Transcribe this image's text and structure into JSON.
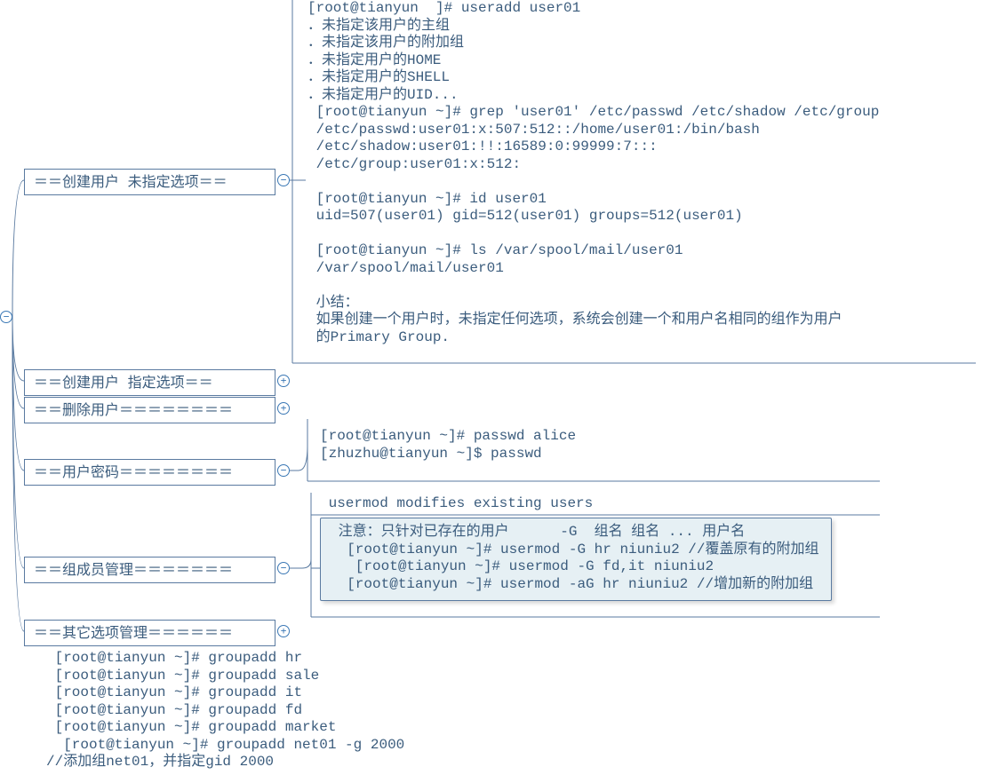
{
  "root_toggle": "minus",
  "nodes": {
    "n1": {
      "label": "＝＝创建用户 未指定选项＝＝",
      "toggle": "minus"
    },
    "n2": {
      "label": "＝＝创建用户    指定选项＝＝",
      "toggle": "plus"
    },
    "n3": {
      "label": "＝＝删除用户＝＝＝＝＝＝＝＝",
      "toggle": "plus"
    },
    "n4": {
      "label": "＝＝用户密码＝＝＝＝＝＝＝＝",
      "toggle": "minus"
    },
    "n5": {
      "label": "＝＝组成员管理＝＝＝＝＝＝＝",
      "toggle": "minus"
    },
    "n6": {
      "label": "＝＝其它选项管理＝＝＝＝＝＝",
      "toggle": "plus"
    }
  },
  "blocks": {
    "b1_lines": [
      "[root@tianyun  ]# useradd user01",
      "．未指定该用户的主组",
      "．未指定该用户的附加组",
      "．未指定用户的HOME",
      "．未指定用户的SHELL",
      "．未指定用户的UID...",
      " [root@tianyun ~]# grep 'user01' /etc/passwd /etc/shadow /etc/group",
      " /etc/passwd:user01:x:507:512::/home/user01:/bin/bash",
      " /etc/shadow:user01:!!:16589:0:99999:7:::",
      " /etc/group:user01:x:512:",
      "",
      " [root@tianyun ~]# id user01",
      " uid=507(user01) gid=512(user01) groups=512(user01)",
      "",
      " [root@tianyun ~]# ls /var/spool/mail/user01",
      " /var/spool/mail/user01",
      "",
      " 小结：",
      " 如果创建一个用户时，未指定任何选项，系统会创建一个和用户名相同的组作为用户",
      " 的Primary Group."
    ],
    "b4_lines": [
      "[root@tianyun ~]# passwd alice",
      "[zhuzhu@tianyun ~]$ passwd"
    ],
    "b5a_lines": [
      " usermod modifies existing users"
    ],
    "b5b_lines": [
      " 注意：只针对已存在的用户      -G  组名 组名 ... 用户名",
      "  [root@tianyun ~]# usermod -G hr niuniu2 //覆盖原有的附加组",
      "   [root@tianyun ~]# usermod -G fd,it niuniu2",
      "  [root@tianyun ~]# usermod -aG hr niuniu2 //增加新的附加组"
    ],
    "bottom_lines": [
      " [root@tianyun ~]# groupadd hr",
      " [root@tianyun ~]# groupadd sale",
      " [root@tianyun ~]# groupadd it",
      " [root@tianyun ~]# groupadd fd",
      " [root@tianyun ~]# groupadd market",
      "  [root@tianyun ~]# groupadd net01 -g 2000",
      "//添加组net01，并指定gid 2000"
    ]
  }
}
